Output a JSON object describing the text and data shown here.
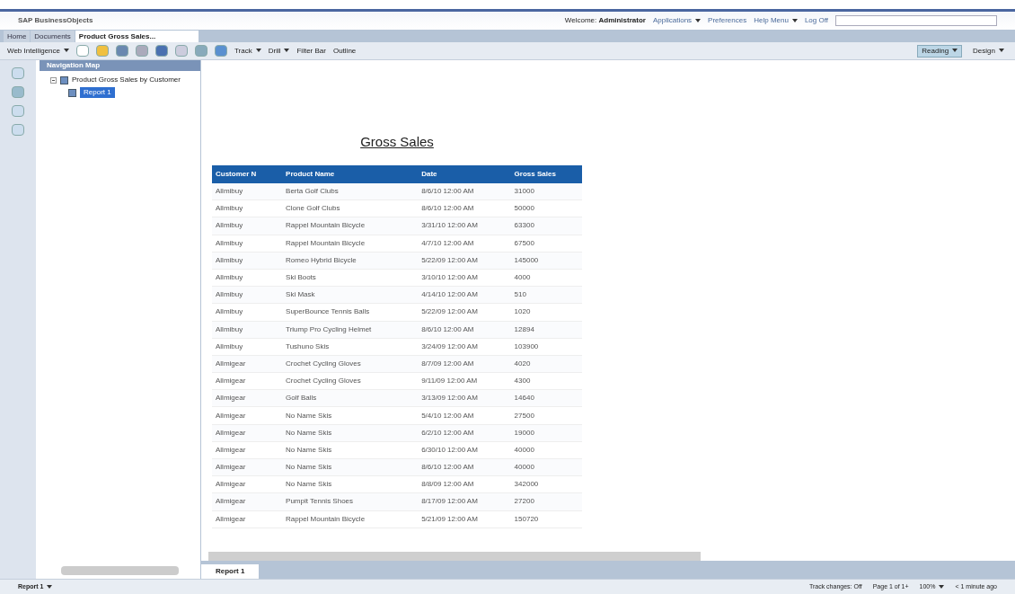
{
  "header": {
    "logo": "SAP BusinessObjects",
    "welcome_label": "Welcome:",
    "user": "Administrator",
    "links": [
      {
        "label": "Applications",
        "dropdown": true
      },
      {
        "label": "Preferences",
        "dropdown": false
      },
      {
        "label": "Help Menu",
        "dropdown": true
      },
      {
        "label": "Log Off",
        "dropdown": false
      }
    ]
  },
  "tabs": [
    {
      "label": "Home",
      "selected": false
    },
    {
      "label": "Documents",
      "selected": false
    },
    {
      "label": "Product Gross Sales...",
      "selected": true
    }
  ],
  "toolbar": {
    "app_menu": "Web Intelligence",
    "items": [
      {
        "label": "Track",
        "dropdown": true
      },
      {
        "label": "Drill",
        "dropdown": true
      },
      {
        "label": "Filter Bar",
        "dropdown": false
      },
      {
        "label": "Outline",
        "dropdown": false
      }
    ],
    "modes": [
      {
        "label": "Reading",
        "selected": true
      },
      {
        "label": "Design",
        "selected": false
      }
    ]
  },
  "navigation_map": {
    "title": "Navigation Map",
    "tree": [
      {
        "label": "Product Gross Sales by Customer",
        "selected": false,
        "expanded": true,
        "children": [
          {
            "label": "Report 1",
            "selected": true
          }
        ]
      }
    ]
  },
  "report": {
    "title": "Gross Sales",
    "table": {
      "columns": [
        "Customer N",
        "Product Name",
        "Date",
        "Gross Sales"
      ],
      "rows": [
        [
          "Allmibuy",
          "Berta Golf Clubs",
          "8/6/10 12:00 AM",
          "31000"
        ],
        [
          "Allmibuy",
          "Clone Golf Clubs",
          "8/6/10 12:00 AM",
          "50000"
        ],
        [
          "Allmibuy",
          "Rappel Mountain Bicycle",
          "3/31/10 12:00 AM",
          "63300"
        ],
        [
          "Allmibuy",
          "Rappel Mountain Bicycle",
          "4/7/10 12:00 AM",
          "67500"
        ],
        [
          "Allmibuy",
          "Romeo Hybrid Bicycle",
          "5/22/09 12:00 AM",
          "145000"
        ],
        [
          "Allmibuy",
          "Ski Boots",
          "3/10/10 12:00 AM",
          "4000"
        ],
        [
          "Allmibuy",
          "Ski Mask",
          "4/14/10 12:00 AM",
          "510"
        ],
        [
          "Allmibuy",
          "SuperBounce Tennis Balls",
          "5/22/09 12:00 AM",
          "1020"
        ],
        [
          "Allmibuy",
          "Triump Pro Cycling Helmet",
          "8/6/10 12:00 AM",
          "12894"
        ],
        [
          "Allmibuy",
          "Tushuno Skis",
          "3/24/09 12:00 AM",
          "103900"
        ],
        [
          "Allmigear",
          "Crochet Cycling Gloves",
          "8/7/09 12:00 AM",
          "4020"
        ],
        [
          "Allmigear",
          "Crochet Cycling Gloves",
          "9/11/09 12:00 AM",
          "4300"
        ],
        [
          "Allmigear",
          "Golf Balls",
          "3/13/09 12:00 AM",
          "14640"
        ],
        [
          "Allmigear",
          "No Name Skis",
          "5/4/10 12:00 AM",
          "27500"
        ],
        [
          "Allmigear",
          "No Name Skis",
          "6/2/10 12:00 AM",
          "19000"
        ],
        [
          "Allmigear",
          "No Name Skis",
          "6/30/10 12:00 AM",
          "40000"
        ],
        [
          "Allmigear",
          "No Name Skis",
          "8/6/10 12:00 AM",
          "40000"
        ],
        [
          "Allmigear",
          "No Name Skis",
          "8/8/09 12:00 AM",
          "342000"
        ],
        [
          "Allmigear",
          "Pumpit Tennis Shoes",
          "8/17/09 12:00 AM",
          "27200"
        ],
        [
          "Allmigear",
          "Rappel Mountain Bicycle",
          "5/21/09 12:00 AM",
          "150720"
        ]
      ]
    },
    "report_tabs": [
      {
        "label": "Report 1",
        "selected": true
      }
    ]
  },
  "status_bar": {
    "report_menu": "Report 1",
    "track_changes": "Track changes: Off",
    "page": "Page 1 of 1+",
    "zoom": "100%",
    "refreshed": "< 1 minute ago"
  }
}
